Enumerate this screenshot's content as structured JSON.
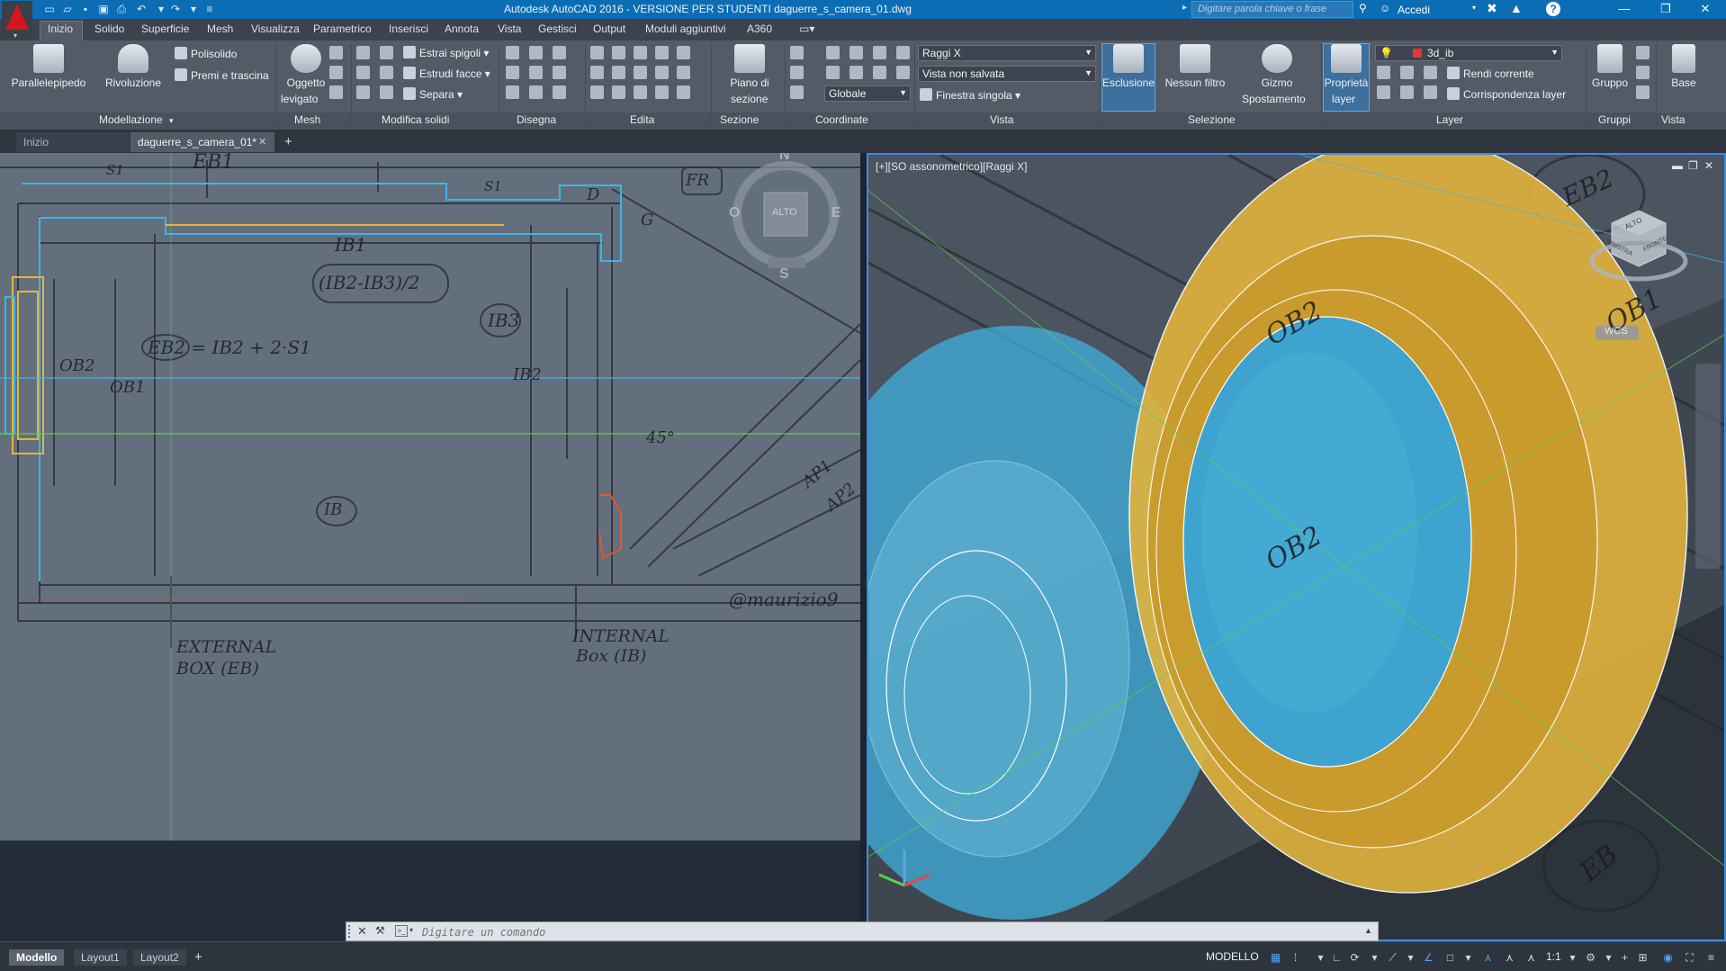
{
  "titlebar": {
    "title": "Autodesk AutoCAD 2016 - VERSIONE PER STUDENTI    daguerre_s_camera_01.dwg",
    "search_placeholder": "Digitare parola chiave o frase",
    "signin": "Accedi"
  },
  "ribbon_tabs": [
    "Inizio",
    "Solido",
    "Superficie",
    "Mesh",
    "Visualizza",
    "Parametrico",
    "Inserisci",
    "Annota",
    "Vista",
    "Gestisci",
    "Output",
    "Moduli aggiuntivi",
    "A360"
  ],
  "panels": {
    "modellazione": {
      "title": "Modellazione",
      "box": "Parallelepipedo",
      "revolve": "Rivoluzione",
      "polysolid": "Polisolido",
      "presspull": "Premi e trascina"
    },
    "mesh": {
      "title": "Mesh",
      "smooth_l1": "Oggetto",
      "smooth_l2": "levigato"
    },
    "modifica_solidi": {
      "title": "Modifica solidi",
      "extract_edges": "Estrai spigoli",
      "extrude_faces": "Estrudi facce",
      "separate": "Separa"
    },
    "disegna": {
      "title": "Disegna"
    },
    "edita": {
      "title": "Edita"
    },
    "sezione": {
      "title": "Sezione",
      "plane_l1": "Piano di",
      "plane_l2": "sezione"
    },
    "coordinate": {
      "title": "Coordinate",
      "ucs": "Globale"
    },
    "vista": {
      "title": "Vista",
      "visual_style": "Raggi X",
      "named_view": "Vista non salvata",
      "viewport_config": "Finestra singola"
    },
    "selezione": {
      "title": "Selezione",
      "culling": "Esclusione",
      "no_filter": "Nessun filtro",
      "gizmo_l1": "Gizmo",
      "gizmo_l2": "Spostamento"
    },
    "layer": {
      "title": "Layer",
      "props_l1": "Proprietà",
      "props_l2": "layer",
      "current_layer": "3d_ib",
      "make_current": "Rendi corrente",
      "match_layer": "Corrispondenza layer"
    },
    "gruppi": {
      "title": "Gruppi",
      "group": "Gruppo"
    },
    "vista2": {
      "title": "Vista",
      "base": "Base"
    }
  },
  "doc_tabs": {
    "home": "Inizio",
    "file": "daguerre_s_camera_01*"
  },
  "viewport_right": {
    "label": "[+][SO assonometrico][Raggi X]"
  },
  "viewcube": {
    "left": {
      "north": "N",
      "south": "S",
      "east": "E",
      "west": "O",
      "face": "ALTO"
    },
    "right": {
      "face_top": "ALTO",
      "face_left": "SINISTRA",
      "face_right": "FRONTE",
      "wcs": "WCS"
    }
  },
  "sketch_labels": {
    "eb1": "EB1",
    "s1": "S1",
    "ib1": "IB1",
    "fr": "FR",
    "formula1": "(IB2-IB3)/2",
    "ib3": "IB3",
    "eb2_formula": "EB2 = IB2 + 2·S1",
    "ob2": "OB2",
    "ob1": "OB1",
    "ib2": "IB2",
    "angle": "45°",
    "ib": "IB",
    "ap1": "AP1",
    "ap2": "AP2",
    "signature": "@maurizio9",
    "ext1": "EXTERNAL",
    "ext2": "BOX (EB)",
    "int1": "INTERNAL",
    "int2": "Box (IB)",
    "g": "G",
    "d": "D",
    "right_eb2": "EB2",
    "right_ob2": "OB2",
    "right_ob1": "OB1",
    "right_eb": "EB"
  },
  "command_line": {
    "placeholder": "Digitare un comando"
  },
  "layout_tabs": [
    "Modello",
    "Layout1",
    "Layout2"
  ],
  "status": {
    "space": "MODELLO",
    "scale": "1:1"
  },
  "colors": {
    "title_blue": "#0b6eb5",
    "ribbon": "#535b67",
    "accent_blue": "#3b8de0",
    "yellow_solid": "#e0b33b",
    "cyan_solid": "#3fb0dc"
  }
}
